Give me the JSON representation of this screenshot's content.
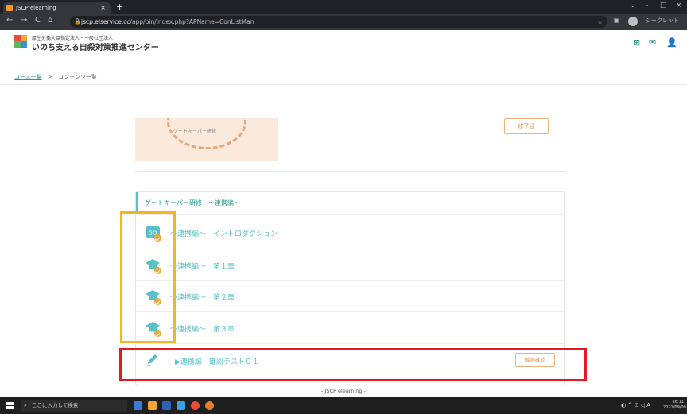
{
  "browser": {
    "tab_title": "JSCP elearning",
    "tab_close": "×",
    "new_tab": "+",
    "nav": {
      "back": "←",
      "forward": "→",
      "reload": "C",
      "home": "⌂"
    },
    "url_host": "jscp.elservice.cc",
    "url_path": "/app/bin/index.php?APName=ConListMan",
    "lock_icon": "lock-icon",
    "profile_label": "シークレット",
    "window": {
      "minimize": "-",
      "maximize": "□",
      "close": "×"
    }
  },
  "site": {
    "org_line1": "厚生労働大臣指定法人・一般社団法人",
    "org_line2": "いのち支える自殺対策推進センター",
    "logo_colors": [
      "#e94b3c",
      "#f3a537",
      "#5cb85c",
      "#3a8fd6"
    ],
    "header_icons": [
      "grid-icon",
      "mail-icon",
      "user-icon"
    ]
  },
  "breadcrumb": {
    "link": "コース一覧",
    "separator": ">",
    "current": "コンテンツ一覧"
  },
  "course": {
    "banner_label": "ゲートキーパー研修",
    "certificate_button": "修了証",
    "section_title": "ゲートキーパー研修　～連携編～",
    "items": [
      {
        "icon": "link-icon",
        "label": "～連携編～　イントロダクション",
        "completed": true
      },
      {
        "icon": "graduation-cap-icon",
        "label": "～連携編～　第１章",
        "completed": true
      },
      {
        "icon": "graduation-cap-icon",
        "label": "～連携編～　第２章",
        "completed": true
      },
      {
        "icon": "graduation-cap-icon",
        "label": "～連携編～　第３章",
        "completed": true
      },
      {
        "icon": "pencil-icon",
        "label": "▶連携編　確認テスト０１",
        "completed": false
      }
    ],
    "answer_button": "解答確認"
  },
  "footer": {
    "text": "- JSCP elearning -"
  },
  "taskbar": {
    "search_placeholder": "ここに入力して検索",
    "clock_time": "16:11",
    "clock_date": "2021/09/09",
    "ime": "A"
  },
  "colors": {
    "accent": "#57c1c5",
    "orange": "#e6873c",
    "highlight_yellow": "#f2b722",
    "highlight_red": "#e21b23"
  }
}
